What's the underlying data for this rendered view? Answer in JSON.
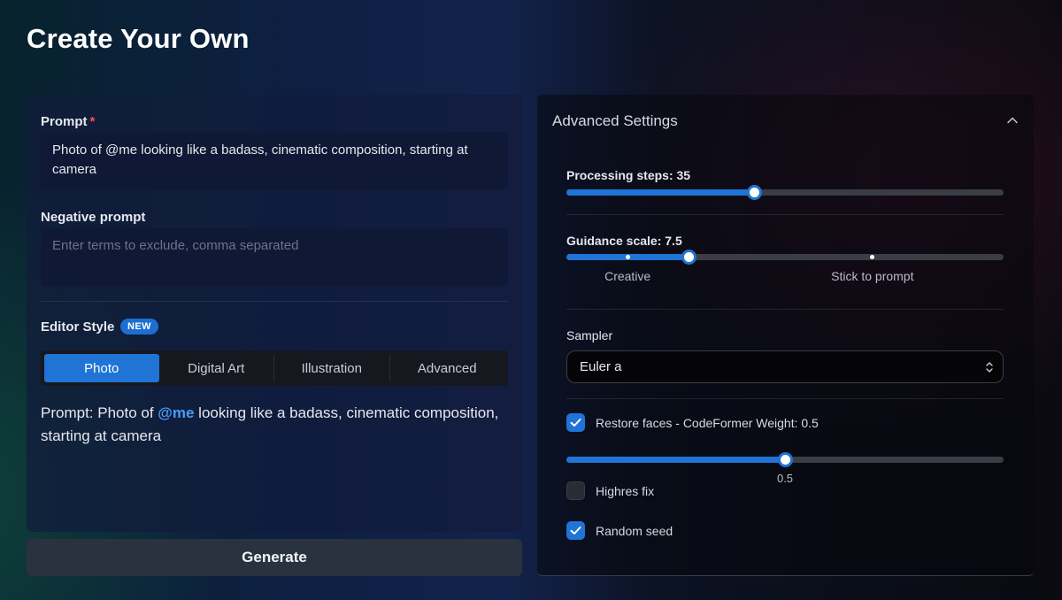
{
  "page": {
    "title": "Create Your Own"
  },
  "prompt": {
    "label": "Prompt",
    "required_mark": "*",
    "value": "Photo of @me looking like a badass, cinematic composition, starting at camera"
  },
  "negative_prompt": {
    "label": "Negative prompt",
    "placeholder": "Enter terms to exclude, comma separated"
  },
  "editor_style": {
    "label": "Editor Style",
    "badge": "NEW",
    "tabs": [
      "Photo",
      "Digital Art",
      "Illustration",
      "Advanced"
    ],
    "selected": "Photo"
  },
  "preview": {
    "prefix": "Prompt: Photo of ",
    "mention": "@me",
    "suffix": " looking like a badass, cinematic composition, starting at camera"
  },
  "generate_label": "Generate",
  "advanced": {
    "title": "Advanced Settings",
    "expanded": true,
    "processing_steps": {
      "label": "Processing steps: 35",
      "fraction": 0.43
    },
    "guidance": {
      "label": "Guidance scale: 7.5",
      "fraction": 0.28,
      "marks": [
        {
          "label": "Creative",
          "fraction": 0.14
        },
        {
          "label": "Stick to prompt",
          "fraction": 0.7
        }
      ]
    },
    "sampler": {
      "label": "Sampler",
      "value": "Euler a"
    },
    "restore_faces": {
      "label": "Restore faces - CodeFormer Weight: 0.5",
      "checked": true,
      "value_label": "0.5",
      "fraction": 0.5
    },
    "highres_fix": {
      "label": "Highres fix",
      "checked": false
    },
    "random_seed": {
      "label": "Random seed",
      "checked": true
    }
  },
  "colors": {
    "accent": "#1f74d6",
    "mention": "#4a9dff",
    "required": "#ff4d57"
  }
}
